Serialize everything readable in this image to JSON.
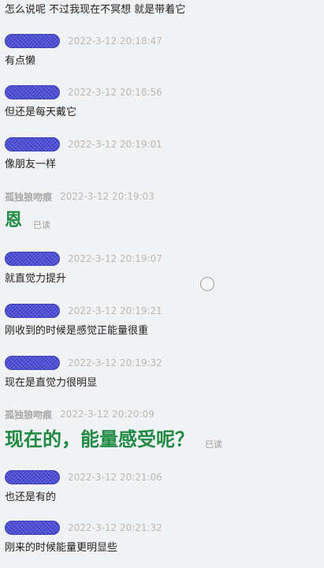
{
  "chat": {
    "top_line": "怎么说呢 不过我现在不冥想 就是带着它",
    "messages": [
      {
        "sender": "",
        "time": "2022-3-12 20:18:47",
        "text": "有点懒"
      },
      {
        "sender": "",
        "time": "2022-3-12 20:18:56",
        "text": "但还是每天戴它"
      },
      {
        "sender": "",
        "time": "2022-3-12 20:19:01",
        "text": "像朋友一样"
      },
      {
        "sender": "孤独狼吻痕",
        "time": "2022-3-12 20:19:03",
        "text": "恩",
        "read_status": "已读"
      },
      {
        "sender": "",
        "time": "2022-3-12 20:19:07",
        "text": "就直觉力提升"
      },
      {
        "sender": "",
        "time": "2022-3-12 20:19:21",
        "text": "刚收到的时候是感觉正能量很重"
      },
      {
        "sender": "",
        "time": "2022-3-12 20:19:32",
        "text": "现在是直觉力很明显"
      },
      {
        "sender": "孤独狼吻痕",
        "time": "2022-3-12 20:20:09",
        "text": "现在的，能量感受呢？",
        "read_status": "已读"
      },
      {
        "sender": "",
        "time": "2022-3-12 20:21:06",
        "text": "也还是有的"
      },
      {
        "sender": "",
        "time": "2022-3-12 20:21:32",
        "text": "刚来的时候能量更明显些"
      }
    ]
  }
}
